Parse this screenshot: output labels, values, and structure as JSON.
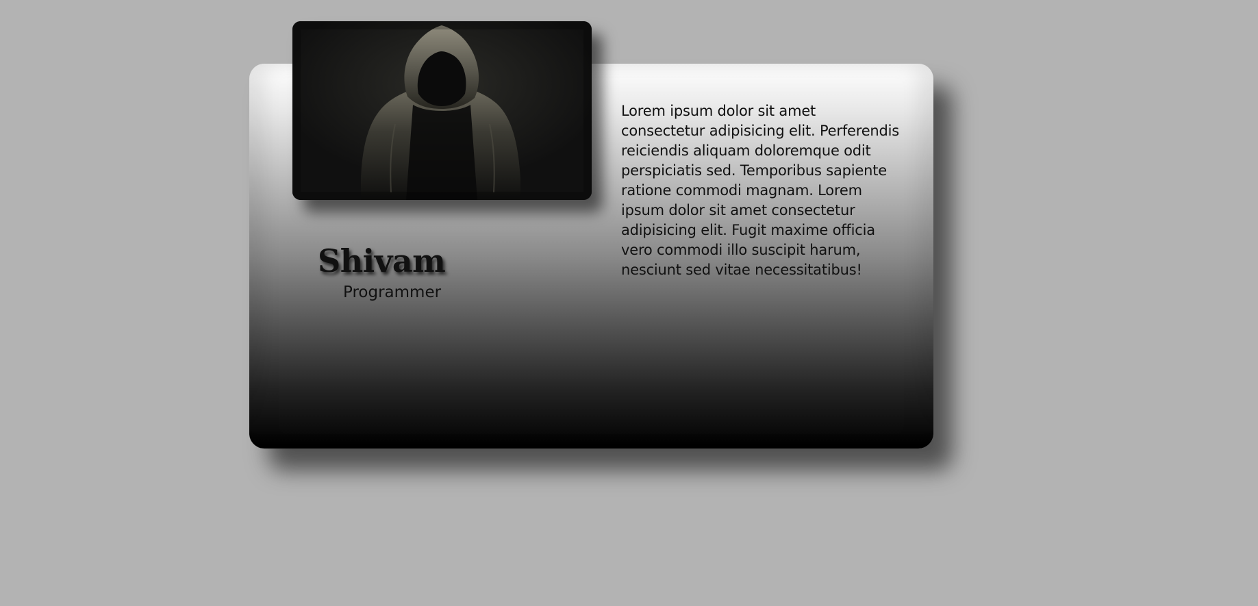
{
  "profile": {
    "name": "Shivam",
    "role": "Programmer",
    "description": "Lorem ipsum dolor sit amet consectetur adipisicing elit. Perferendis reiciendis aliquam doloremque odit perspiciatis sed. Temporibus sapiente ratione commodi magnam. Lorem ipsum dolor sit amet consectetur adipisicing elit. Fugit maxime officia vero commodi illo suscipit harum, nesciunt sed vitae necessitatibus!",
    "photo_icon": "hooded-figure-photo"
  },
  "colors": {
    "page_background": "#b3b3b3",
    "card_top": "#ffffff",
    "card_bottom": "#000000",
    "text": "#111111"
  }
}
